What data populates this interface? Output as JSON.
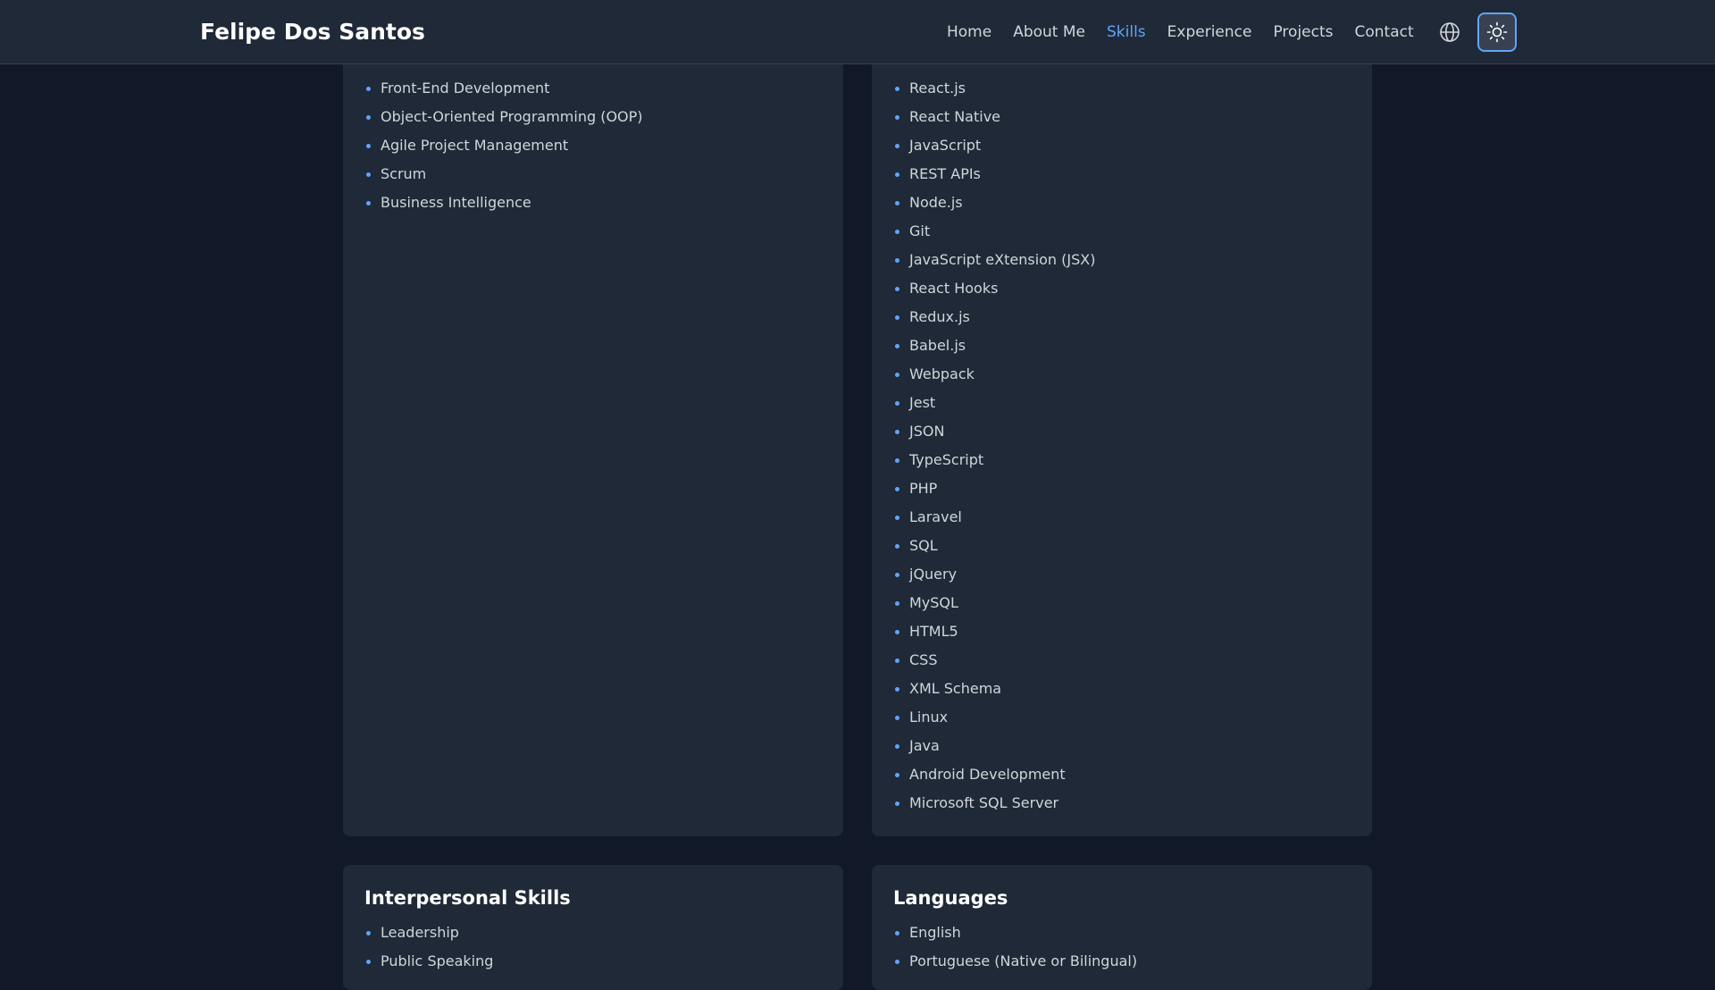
{
  "header": {
    "brand": "Felipe Dos Santos",
    "nav": [
      {
        "label": "Home",
        "active": false
      },
      {
        "label": "About Me",
        "active": false
      },
      {
        "label": "Skills",
        "active": true
      },
      {
        "label": "Experience",
        "active": false
      },
      {
        "label": "Projects",
        "active": false
      },
      {
        "label": "Contact",
        "active": false
      }
    ],
    "language_icon": "globe-icon",
    "theme_icon": "sun-icon"
  },
  "colors": {
    "background": "#111827",
    "card": "#1f2937",
    "accent": "#60a5fa",
    "text": "#d1d5db",
    "heading": "#ffffff"
  },
  "skills": {
    "methods": [
      "Front-End Development",
      "Object-Oriented Programming (OOP)",
      "Agile Project Management",
      "Scrum",
      "Business Intelligence"
    ],
    "technologies": [
      "React.js",
      "React Native",
      "JavaScript",
      "REST APIs",
      "Node.js",
      "Git",
      "JavaScript eXtension (JSX)",
      "React Hooks",
      "Redux.js",
      "Babel.js",
      "Webpack",
      "Jest",
      "JSON",
      "TypeScript",
      "PHP",
      "Laravel",
      "SQL",
      "jQuery",
      "MySQL",
      "HTML5",
      "CSS",
      "XML Schema",
      "Linux",
      "Java",
      "Android Development",
      "Microsoft SQL Server"
    ],
    "interpersonal": {
      "title": "Interpersonal Skills",
      "items": [
        "Leadership",
        "Public Speaking"
      ]
    },
    "languages": {
      "title": "Languages",
      "items": [
        "English",
        "Portuguese (Native or Bilingual)"
      ]
    }
  }
}
